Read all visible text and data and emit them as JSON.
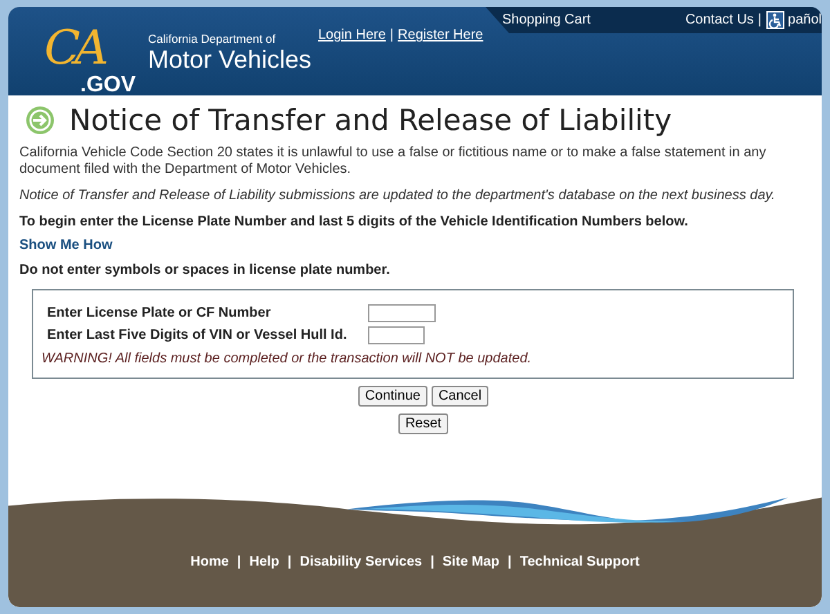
{
  "header": {
    "logo": {
      "mark": "CA",
      "suffix": ".GOV"
    },
    "agency": "California Department of",
    "agency_name": "Motor Vehicles",
    "account_links": [
      "Login Here",
      "Register Here"
    ],
    "separator": "|",
    "cart": "Shopping Cart",
    "contact": "Contact Us",
    "language": "pañol"
  },
  "page": {
    "title": "Notice of Transfer and Release of Liability",
    "warning_text": "California Vehicle Code Section 20 states it is unlawful to use a false or fictitious name or to make a false statement in any document filed with the Department of Motor Vehicles.",
    "notice": "Notice of Transfer and Release of Liability submissions are updated to the department's database on the next business day.",
    "instructions": "To begin enter the License Plate Number and last 5 digits of the Vehicle Identification Numbers below.",
    "help_link": "Show Me How",
    "note": "Do not enter symbols or spaces in license plate number."
  },
  "form": {
    "fields": [
      {
        "label": "Enter License Plate or CF Number"
      },
      {
        "label": "Enter Last Five Digits of VIN or Vessel Hull Id."
      }
    ],
    "alert": "WARNING! All fields must be completed or the transaction will NOT be updated.",
    "buttons": [
      "Continue",
      "Cancel"
    ],
    "reset": "Reset"
  },
  "footer": {
    "links": [
      "Home",
      "Help",
      "Disability Services",
      "Site Map",
      "Technical Support"
    ],
    "separator": "|"
  }
}
